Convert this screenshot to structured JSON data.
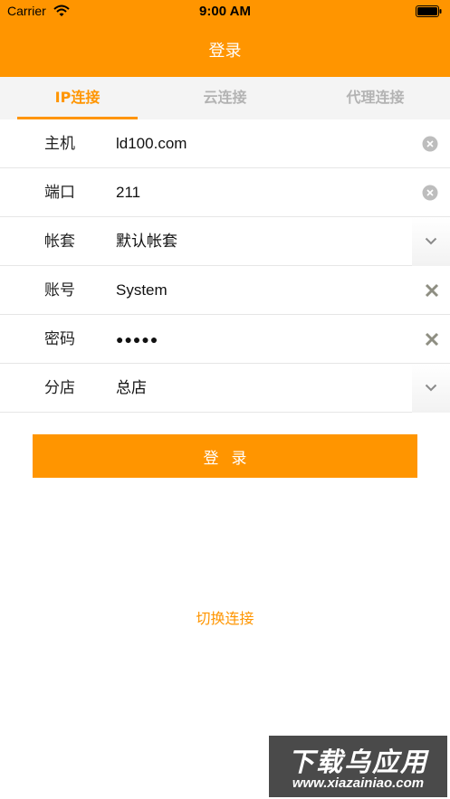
{
  "status_bar": {
    "carrier": "Carrier",
    "time": "9:00 AM"
  },
  "nav": {
    "title": "登录"
  },
  "tabs": [
    {
      "label": "IP连接",
      "active": true
    },
    {
      "label": "云连接",
      "active": false
    },
    {
      "label": "代理连接",
      "active": false
    }
  ],
  "form": {
    "host": {
      "label": "主机",
      "value": "ld100.com",
      "action_icon": "clear-circle-icon"
    },
    "port": {
      "label": "端口",
      "value": "211",
      "action_icon": "clear-circle-icon"
    },
    "account_set": {
      "label": "帐套",
      "value": "默认帐套",
      "action_icon": "chevron-down-icon"
    },
    "account": {
      "label": "账号",
      "value": "System",
      "action_icon": "x-icon"
    },
    "password": {
      "label": "密码",
      "value": "●●●●●",
      "action_icon": "x-icon"
    },
    "branch": {
      "label": "分店",
      "value": "总店",
      "action_icon": "chevron-down-icon"
    }
  },
  "login_button": {
    "label": "登录"
  },
  "switch_link": {
    "label": "切换连接"
  },
  "watermark": {
    "title": "下载乌应用",
    "url": "www.xiazainiao.com"
  },
  "colors": {
    "accent": "#FF9500",
    "tab_bg": "#F4F4F4",
    "inactive_tab": "#B3B3B3",
    "divider": "#E6E6E6"
  }
}
